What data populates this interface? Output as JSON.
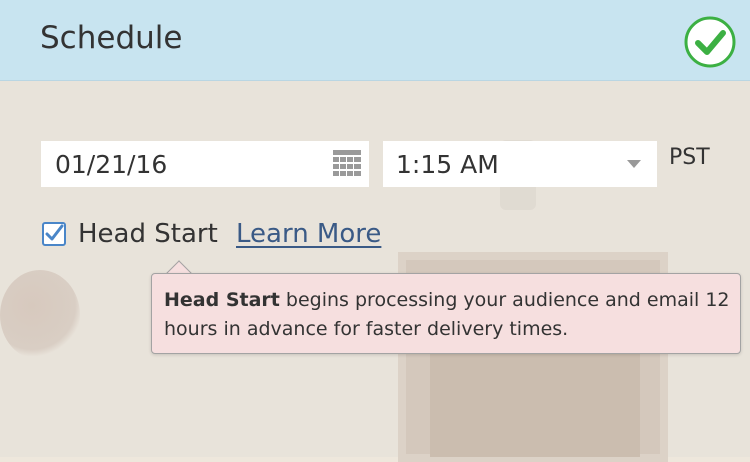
{
  "header": {
    "title": "Schedule",
    "confirm_icon": "check-circle-icon",
    "background_color": "#c8e4f0",
    "confirm_color": "#3cb043"
  },
  "schedule": {
    "date_value": "01/21/16",
    "calendar_icon": "calendar-icon",
    "time_value": "1:15 AM",
    "dropdown_icon": "chevron-down-icon",
    "timezone": "PST"
  },
  "head_start": {
    "checked": true,
    "label": "Head Start",
    "learn_more": "Learn More",
    "link_color": "#3a5a86"
  },
  "tooltip": {
    "bold": "Head Start",
    "text": " begins processing your audience and email 12 hours in advance for faster delivery times.",
    "background_color": "#f6dfdf"
  }
}
